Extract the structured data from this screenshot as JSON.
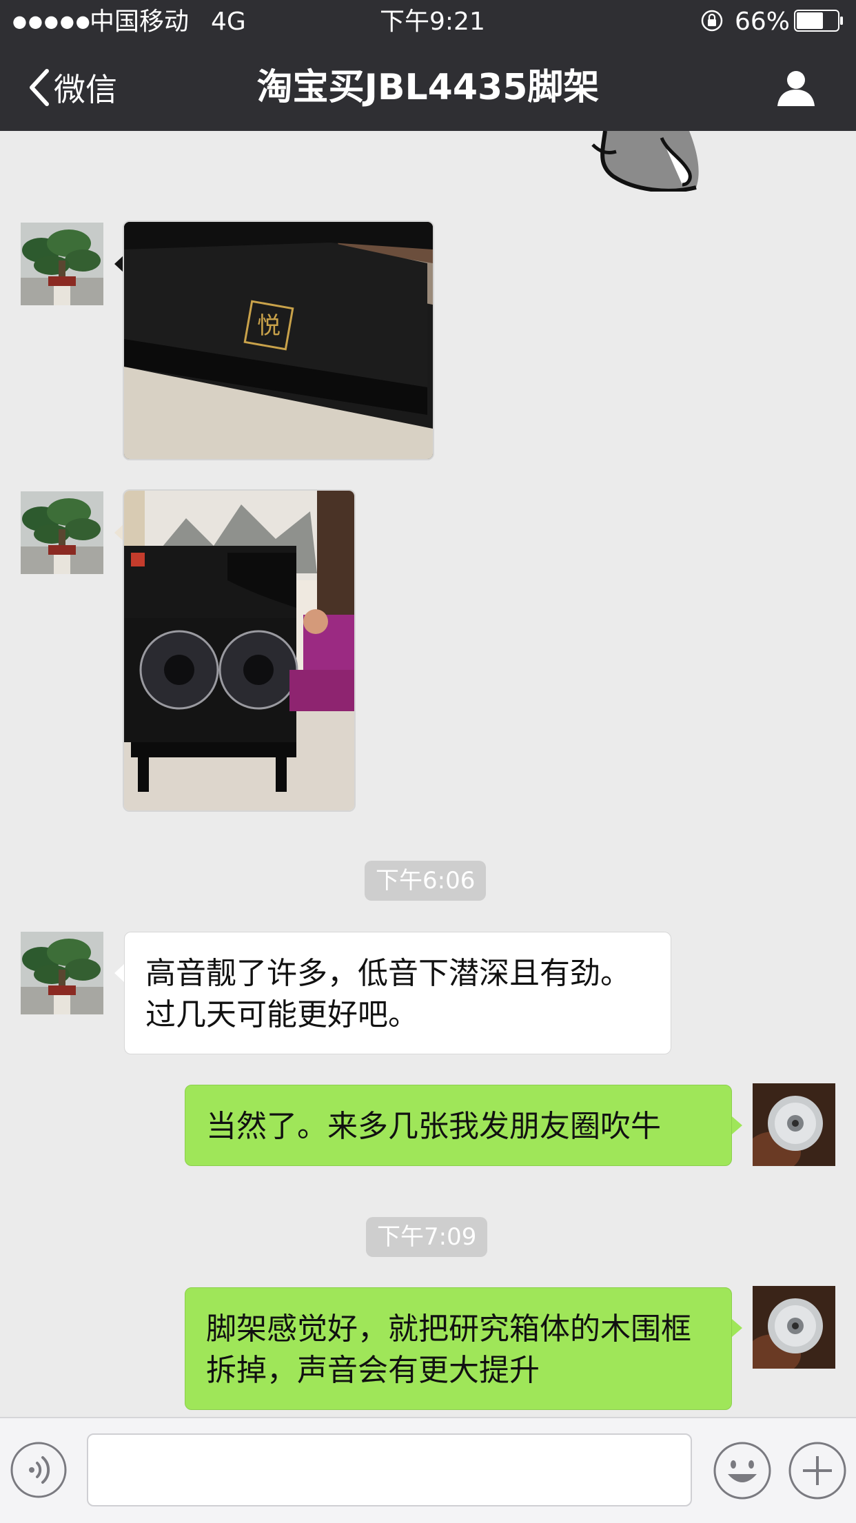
{
  "status_bar": {
    "signal_dots": "●●●●●",
    "carrier": "中国移动",
    "network": "4G",
    "time": "下午9:21",
    "battery": "66%",
    "battery_level": 0.66
  },
  "nav": {
    "back_label": "微信",
    "title": "淘宝买JBL4435脚架"
  },
  "messages": {
    "photo1_badge": "悦",
    "ts1": "下午6:06",
    "m1": "高音靓了许多，低音下潜深且有劲。过几天可能更好吧。",
    "m2": "当然了。来多几张我发朋友圈吹牛",
    "ts2": "下午7:09",
    "m3": "脚架感觉好，就把研究箱体的木围框拆掉，声音会有更大提升"
  },
  "input": {
    "value": "",
    "placeholder": ""
  }
}
